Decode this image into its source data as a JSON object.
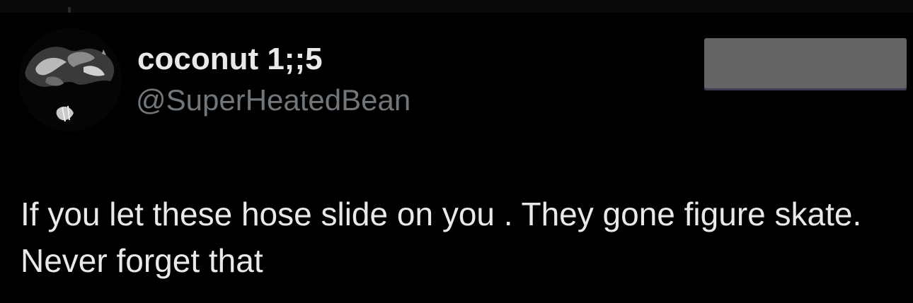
{
  "tweet": {
    "author": {
      "display_name": "coconut 1;;5",
      "handle": "@SuperHeatedBean",
      "avatar_icon": "profile-photo"
    },
    "text": "If you let these hose slide on you . They gone figure skate. Never forget that",
    "redacted_region": true
  },
  "colors": {
    "background": "#000000",
    "primary_text": "#e7e9ea",
    "secondary_text": "#71767b",
    "redaction": "#646466"
  }
}
